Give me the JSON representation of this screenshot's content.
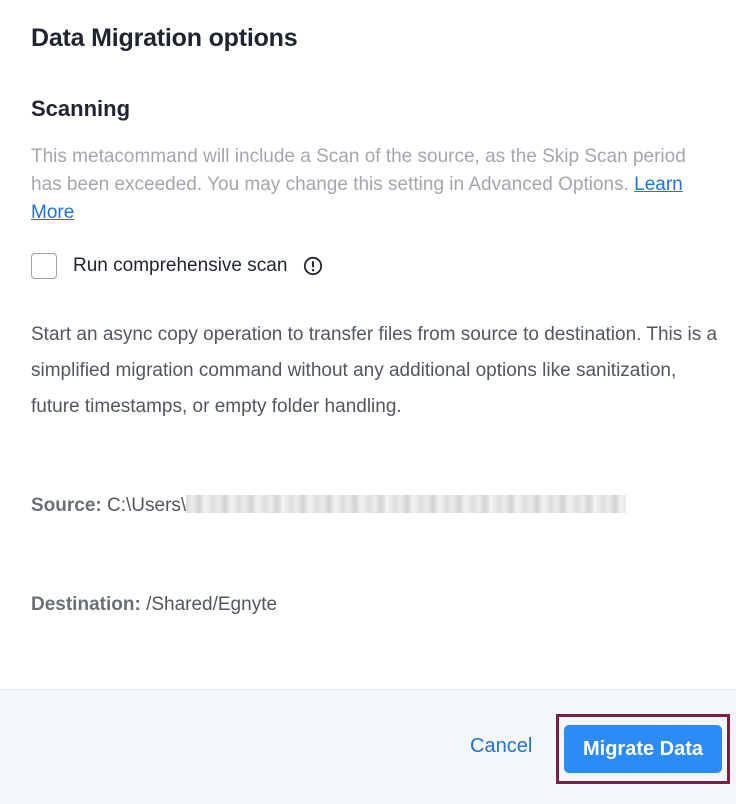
{
  "dialog": {
    "title": "Data Migration options"
  },
  "scanning": {
    "heading": "Scanning",
    "note": "This metacommand will include a Scan of the source, as the Skip Scan period has been exceeded. You may change this setting in Advanced Options.",
    "learn_more_label": "Learn More",
    "checkbox_label": "Run comprehensive scan",
    "checkbox_checked": false,
    "info_icon": "info-icon"
  },
  "description": "Start an async copy operation to transfer files from source to destination. This is a simplified migration command without any additional options like sanitization, future timestamps, or empty folder handling.",
  "source": {
    "label": "Source:",
    "value_prefix": "C:\\Users\\"
  },
  "destination": {
    "label": "Destination:",
    "value": "/Shared/Egnyte"
  },
  "footer": {
    "cancel_label": "Cancel",
    "migrate_label": "Migrate Data"
  },
  "colors": {
    "accent": "#2b8cf6",
    "link": "#1e73d8",
    "highlight_border": "#7a1f48",
    "footer_bg": "#f4f7fa"
  }
}
